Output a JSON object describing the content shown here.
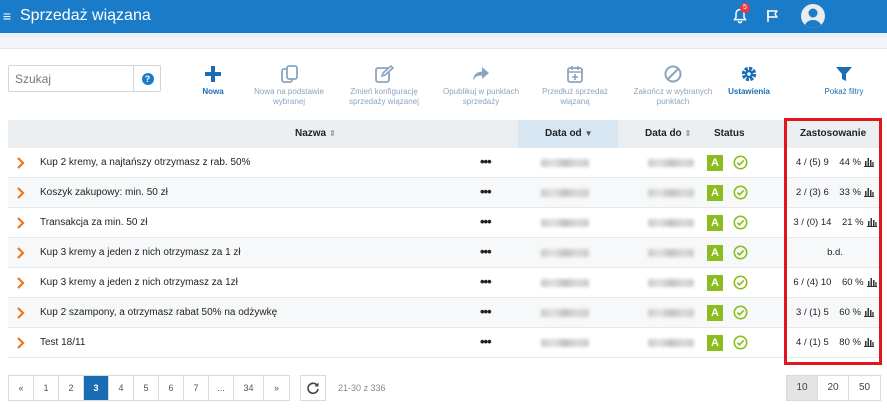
{
  "app": {
    "title": "Sprzedaż wiązana",
    "notification_count": "5"
  },
  "search": {
    "placeholder": "Szukaj",
    "help": "?"
  },
  "toolbar": [
    {
      "label": "Nowa",
      "icon": "plus-icon",
      "active": true
    },
    {
      "label": "Nowa na podstawie wybranej",
      "icon": "copy-icon",
      "active": false
    },
    {
      "label": "Zmień konfigurację sprzedaży wiązanej",
      "icon": "edit-icon",
      "active": false
    },
    {
      "label": "Opublikuj w punktach sprzedaży",
      "icon": "share-icon",
      "active": false
    },
    {
      "label": "Przedłuż sprzedaż wiązaną",
      "icon": "calendar-plus-icon",
      "active": false
    },
    {
      "label": "Zakończ w wybranych punktach",
      "icon": "ban-icon",
      "active": false
    },
    {
      "label": "Ustawienia",
      "icon": "gear-icon",
      "active": true
    },
    {
      "label": "Pokaż filtry",
      "icon": "filter-icon",
      "active": false
    }
  ],
  "table": {
    "columns": {
      "name": "Nazwa",
      "date_from": "Data od",
      "date_to": "Data do",
      "status": "Status",
      "usage": "Zastosowanie"
    },
    "rows": [
      {
        "name": "Kup 2 kremy, a najtańszy otrzymasz z rab. 50%",
        "status": "A",
        "usage": "4 / (5) 9    44 %"
      },
      {
        "name": "Koszyk zakupowy: min. 50 zł",
        "status": "A",
        "usage": "2 / (3) 6    33 %"
      },
      {
        "name": "Transakcja za min. 50 zł",
        "status": "A",
        "usage": "3 / (0) 14    21 %"
      },
      {
        "name": "Kup 3 kremy a jeden z nich otrzymasz za 1 zł",
        "status": "A",
        "usage": "b.d."
      },
      {
        "name": "Kup 3 kremy a jeden z nich otrzymasz za 1zł",
        "status": "A",
        "usage": "6 / (4) 10    60 %"
      },
      {
        "name": "Kup 2 szampony, a otrzymasz rabat 50% na odżywkę",
        "status": "A",
        "usage": "3 / (1) 5    60 %"
      },
      {
        "name": "Test 18/11",
        "status": "A",
        "usage": "4 / (1) 5    80 %"
      }
    ]
  },
  "pagination": {
    "pages": [
      "«",
      "1",
      "2",
      "3",
      "4",
      "5",
      "6",
      "7",
      "...",
      "34",
      "»"
    ],
    "current": "3",
    "range_text": "21-30 z 336",
    "page_sizes": [
      "10",
      "20",
      "50"
    ],
    "current_size": "10"
  },
  "colors": {
    "brand": "#1a7cc9",
    "status_active": "#8bbd1e",
    "highlight": "#e0161e"
  }
}
